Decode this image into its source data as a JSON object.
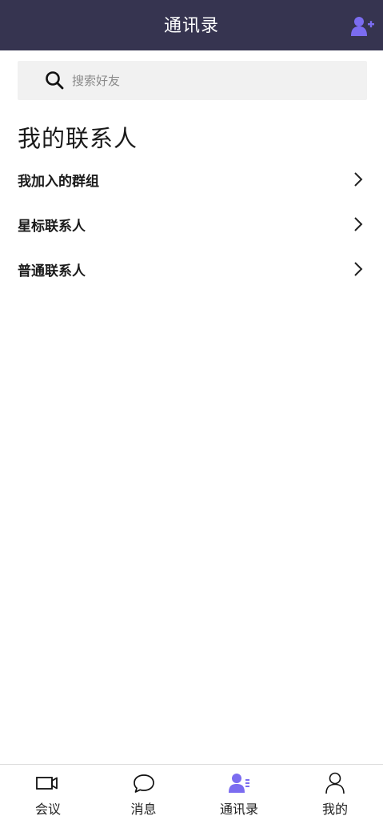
{
  "header": {
    "title": "通讯录"
  },
  "search": {
    "placeholder": "搜索好友"
  },
  "section": {
    "title": "我的联系人"
  },
  "list": {
    "items": [
      {
        "label": "我加入的群组"
      },
      {
        "label": "星标联系人"
      },
      {
        "label": "普通联系人"
      }
    ]
  },
  "tabbar": {
    "tabs": [
      {
        "label": "会议",
        "icon": "video-camera-icon",
        "active": false
      },
      {
        "label": "消息",
        "icon": "chat-bubble-icon",
        "active": false
      },
      {
        "label": "通讯录",
        "icon": "contacts-icon",
        "active": true
      },
      {
        "label": "我的",
        "icon": "person-icon",
        "active": false
      }
    ]
  },
  "colors": {
    "header_bg": "#363450",
    "accent": "#7b6cf0",
    "search_bg": "#f1f1f1"
  }
}
